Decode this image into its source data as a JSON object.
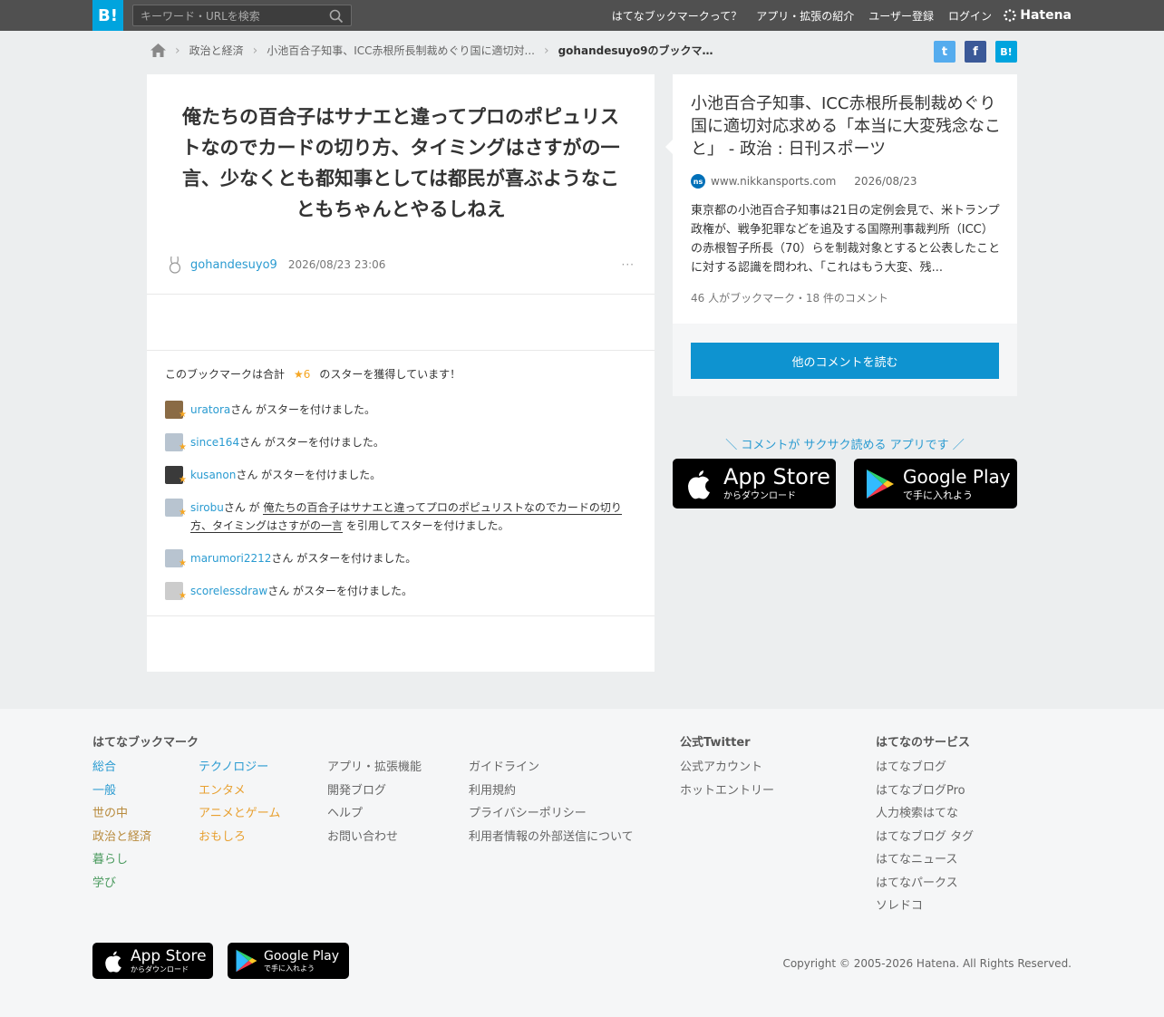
{
  "header": {
    "logo": "B!",
    "search_placeholder": "キーワード・URLを検索",
    "nav": [
      "はてなブックマークって？",
      "アプリ・拡張の紹介",
      "ユーザー登録",
      "ログイン"
    ],
    "brand": "Hatena"
  },
  "breadcrumb": {
    "items": [
      "政治と経済",
      "小池百合子知事、ICC赤根所長制裁めぐり国に適切対..."
    ],
    "current": "gohandesuyo9のブックマ…"
  },
  "share": {
    "twitter": "t",
    "facebook": "f",
    "hatena": "B!"
  },
  "bookmark": {
    "comment": "俺たちの百合子はサナエと違ってプロのポピュリストなのでカードの切り方、タイミングはさすがの一言、少なくとも都知事としては都民が喜ぶようなこともちゃんとやるしねえ",
    "user": "gohandesuyo9",
    "date": "2026/08/23 23:06",
    "more": "···"
  },
  "stars": {
    "summary_prefix": "このブックマークは合計",
    "count": "★6",
    "summary_suffix": "のスターを獲得しています！",
    "rows": [
      {
        "name": "uratora",
        "text": "さん がスターを付けました。"
      },
      {
        "name": "since164",
        "text": "さん がスターを付けました。"
      },
      {
        "name": "kusanon",
        "text": "さん がスターを付けました。"
      },
      {
        "name": "sirobu",
        "pre": "さん が ",
        "quote": "俺たちの百合子はサナエと違ってプロのポピュリストなのでカードの切り方、タイミングはさすがの一言",
        "post": " を引用してスターを付けました。"
      },
      {
        "name": "marumori2212",
        "text": "さん がスターを付けました。"
      },
      {
        "name": "scorelessdraw",
        "text": "さん がスターを付けました。"
      }
    ]
  },
  "entry": {
    "title": "小池百合子知事、ICC赤根所長制裁めぐり国に適切対応求める「本当に大変残念なこと」 - 政治 : 日刊スポーツ",
    "site_icon": "ns",
    "site": "www.nikkansports.com",
    "date": "2026/08/23",
    "summary": "東京都の小池百合子知事は21日の定例会見で、米トランプ政権が、戦争犯罪などを追及する国際刑事裁判所（ICC）の赤根智子所長（70）らを制裁対象とすると公表したことに対する認識を問われ、「これはもう大変、残...",
    "count": "46 人がブックマーク・18 件のコメント",
    "read_more": "他のコメントを読む"
  },
  "promo": {
    "text": "＼ コメントが サクサク読める アプリです ／",
    "appstore_big": "App Store",
    "appstore_small": "からダウンロード",
    "googleplay_big": "Google Play",
    "googleplay_small": "で手に入れよう"
  },
  "footer": {
    "bookmark_title": "はてなブックマーク",
    "categories_a": [
      "総合",
      "一般",
      "世の中",
      "政治と経済",
      "暮らし",
      "学び"
    ],
    "categories_b": [
      "テクノロジー",
      "エンタメ",
      "アニメとゲーム",
      "おもしろ"
    ],
    "links_a": [
      "アプリ・拡張機能",
      "開発ブログ",
      "ヘルプ",
      "お問い合わせ"
    ],
    "links_b": [
      "ガイドライン",
      "利用規約",
      "プライバシーポリシー",
      "利用者情報の外部送信について"
    ],
    "twitter_title": "公式Twitter",
    "twitter_links": [
      "公式アカウント",
      "ホットエントリー"
    ],
    "services_title": "はてなのサービス",
    "services": [
      "はてなブログ",
      "はてなブログPro",
      "人力検索はてな",
      "はてなブログ タグ",
      "はてなニュース",
      "はてなパークス",
      "ソレドコ"
    ],
    "copyright": "Copyright © 2005-2026 Hatena. All Rights Reserved.",
    "colors": {
      "categories_a": [
        "#2a9bd1",
        "#2a9bd1",
        "#b88a3c",
        "#b88a3c",
        "#4a9a5e",
        "#4a9a5e"
      ],
      "categories_b": [
        "#2a9bd1",
        "#e8a030",
        "#e8a030",
        "#e8a030"
      ]
    }
  }
}
